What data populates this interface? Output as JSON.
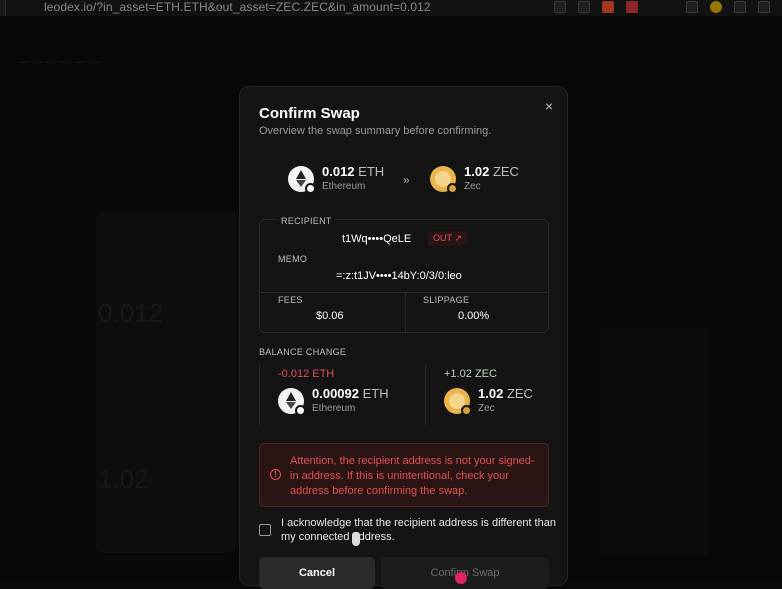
{
  "browser": {
    "url": "leodex.io/?in_asset=ETH.ETH&out_asset=ZEC.ZEC&in_amount=0.012"
  },
  "background": {
    "amount_in": "0.012",
    "amount_out": "1.02"
  },
  "modal": {
    "title": "Confirm Swap",
    "subtitle": "Overview the swap summary before confirming.",
    "close_label": "×",
    "from": {
      "amount": "0.012",
      "symbol": "ETH",
      "network": "Ethereum",
      "icon": "eth-icon"
    },
    "arrow": "»",
    "to": {
      "amount": "1.02",
      "symbol": "ZEC",
      "network": "Zec",
      "icon": "zec-icon"
    },
    "recipient_label": "RECIPIENT",
    "recipient_value": "t1Wq••••QeLE",
    "out_badge": "OUT ↗",
    "memo_label": "MEMO",
    "memo_value": "=:z:t1JV••••14bY:0/3/0:leo",
    "fees_label": "FEES",
    "fees_value": "$0.06",
    "slippage_label": "SLIPPAGE",
    "slippage_value": "0.00%",
    "balance_change_label": "BALANCE CHANGE",
    "balance_left": {
      "delta": "-0.012 ETH",
      "amount": "0.00092",
      "symbol": "ETH",
      "network": "Ethereum"
    },
    "balance_right": {
      "delta": "+1.02 ZEC",
      "amount": "1.02",
      "symbol": "ZEC",
      "network": "Zec"
    },
    "warning_text": "Attention, the recipient address is not your signed-in address. If this is unintentional, check your address before confirming the swap.",
    "ack_text": "I acknowledge that the recipient address is different than my connected address.",
    "cancel_label": "Cancel",
    "confirm_label": "Confirm Swap"
  },
  "colors": {
    "danger": "#e05252",
    "modal_bg": "#141414"
  }
}
